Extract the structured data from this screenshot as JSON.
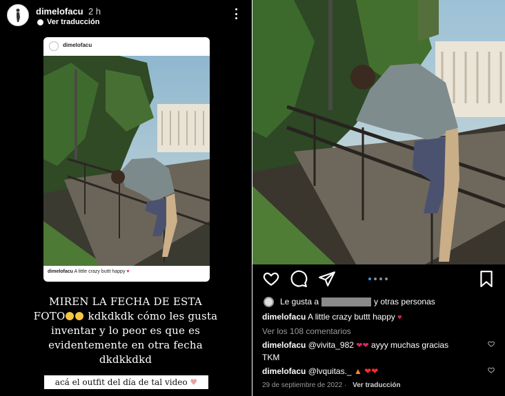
{
  "story": {
    "username": "dimelofacu",
    "time": "2 h",
    "translate": "Ver traducción",
    "card": {
      "username": "dimelofacu",
      "caption_user": "dimelofacu",
      "caption_text": "A little crazy buttt happy"
    },
    "text_line1": "MIREN LA FECHA DE ESTA",
    "text_line2a": "FOTO",
    "text_line2b": " kdkdkdk cómo les gusta",
    "text_line3": "inventar y lo peor es que es",
    "text_line4": "evidentemente en otra fecha",
    "text_line5": "dkdkkdkd",
    "sticker": "acá el outfit del día de tal video"
  },
  "post": {
    "likes_prefix": "Le gusta a",
    "likes_suffix": "y otras personas",
    "caption_user": "dimelofacu",
    "caption_text": "A little crazy buttt happy",
    "view_comments": "Ver los 108 comentarios",
    "comments": [
      {
        "user": "dimelofacu",
        "text": "@vivita_982",
        "text2": "ayyy muchas gracias",
        "text3": "TKM"
      },
      {
        "user": "dimelofacu",
        "text": "@lvquitas._"
      }
    ],
    "date": "29 de septiembre de 2022",
    "translate": "Ver traducción",
    "carousel_count": 4,
    "carousel_active": 1
  },
  "colors": {
    "background": "#000000",
    "accent_blue": "#3897f0",
    "heart": "#e0245e"
  },
  "icons": [
    "avatar-icon",
    "globe-icon",
    "more-vertical-icon",
    "heart-icon",
    "comment-icon",
    "share-icon",
    "bookmark-icon"
  ]
}
